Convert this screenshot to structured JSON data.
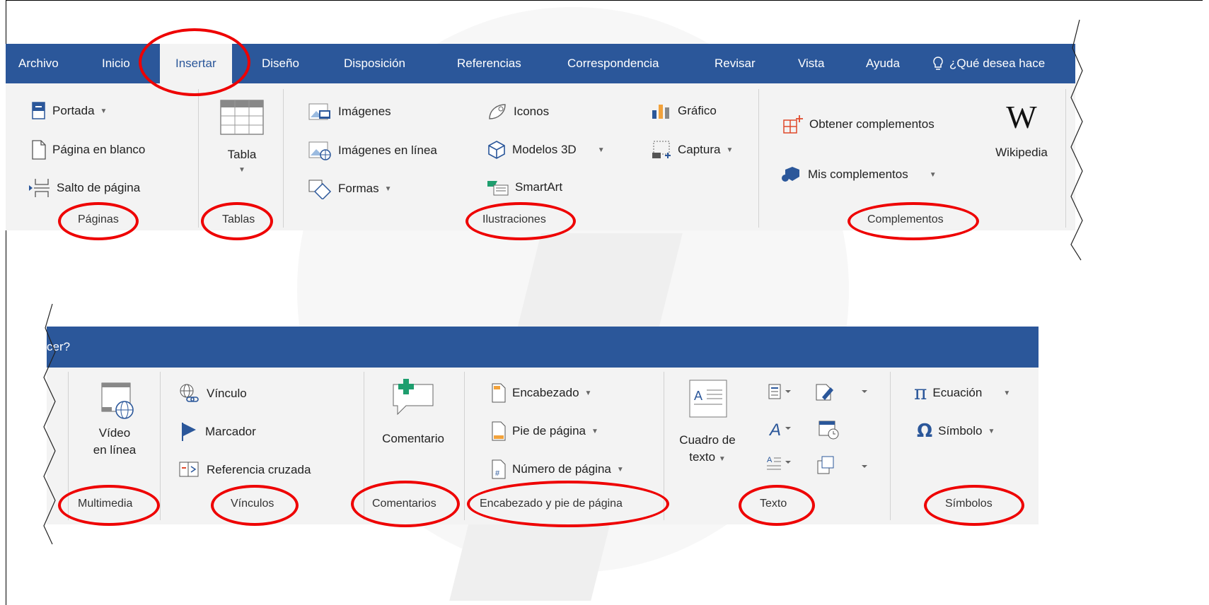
{
  "top": {
    "tabs": [
      "Archivo",
      "Inicio",
      "Insertar",
      "Diseño",
      "Disposición",
      "Referencias",
      "Correspondencia",
      "Revisar",
      "Vista",
      "Ayuda"
    ],
    "search": "¿Qué desea hace",
    "paginas": {
      "portada": "Portada",
      "pagina_blanco": "Página en blanco",
      "salto": "Salto de página",
      "group": "Páginas"
    },
    "tablas": {
      "tabla": "Tabla",
      "group": "Tablas"
    },
    "ilustraciones": {
      "imagenes": "Imágenes",
      "imagenes_linea": "Imágenes en línea",
      "formas": "Formas",
      "iconos": "Iconos",
      "modelos": "Modelos 3D",
      "smartart": "SmartArt",
      "grafico": "Gráfico",
      "captura": "Captura",
      "group": "Ilustraciones"
    },
    "complementos": {
      "obtener": "Obtener complementos",
      "mis": "Mis complementos",
      "wikipedia": "Wikipedia",
      "group": "Complementos"
    }
  },
  "bottom": {
    "search": "cer?",
    "multimedia": {
      "video1": "Vídeo",
      "video2": "en línea",
      "group": "Multimedia"
    },
    "vinculos": {
      "vinculo": "Vínculo",
      "marcador": "Marcador",
      "referencia": "Referencia cruzada",
      "group": "Vínculos"
    },
    "comentarios": {
      "comentario": "Comentario",
      "group": "Comentarios"
    },
    "encabezado": {
      "encabezado": "Encabezado",
      "pie": "Pie de página",
      "numero": "Número de página",
      "group": "Encabezado y pie de página"
    },
    "texto": {
      "cuadro1": "Cuadro de",
      "cuadro2": "texto",
      "group": "Texto"
    },
    "simbolos": {
      "ecuacion": "Ecuación",
      "simbolo": "Símbolo",
      "group": "Símbolos"
    }
  },
  "colors": {
    "ribbon_blue": "#2b579a",
    "ribbon_bg": "#f3f3f3",
    "highlight_red": "#e00000"
  }
}
